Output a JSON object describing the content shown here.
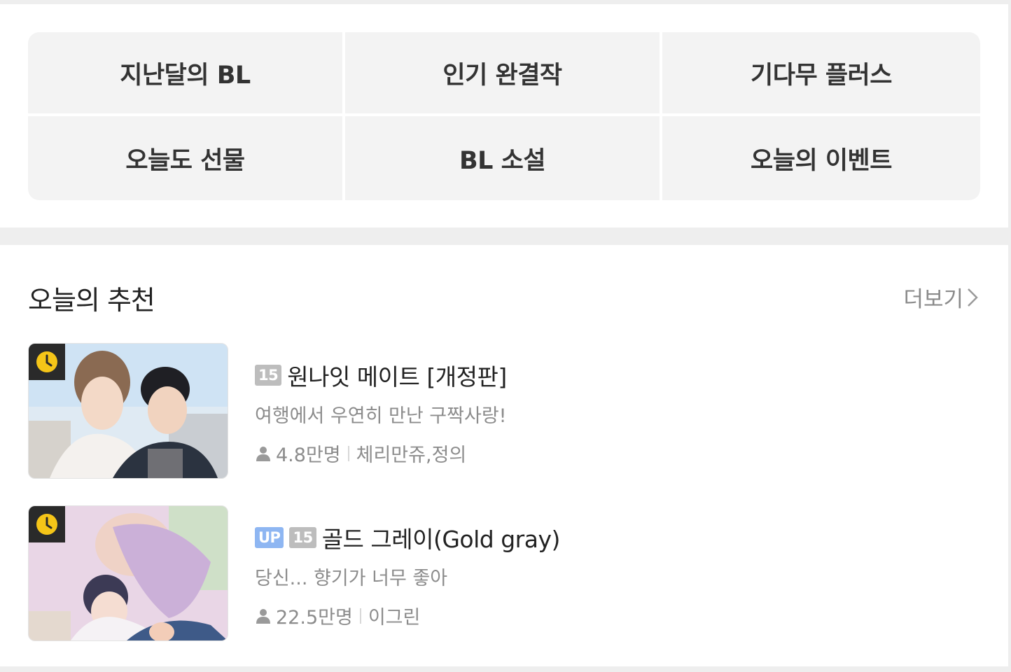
{
  "menu": {
    "items": [
      {
        "label": "지난달의 BL"
      },
      {
        "label": "인기 완결작"
      },
      {
        "label": "기다무 플러스"
      },
      {
        "label": "오늘도 선물"
      },
      {
        "label": "BL 소설"
      },
      {
        "label": "오늘의 이벤트"
      }
    ]
  },
  "recommend": {
    "title": "오늘의 추천",
    "more_label": "더보기",
    "items": [
      {
        "badges": [
          "15"
        ],
        "title": "원나잇 메이트 [개정판]",
        "description": "여행에서 우연히 만난 구짝사랑!",
        "views": "4.8만명",
        "authors": "체리만쥬,정의",
        "thumb_icon": "clock-icon"
      },
      {
        "badges": [
          "UP",
          "15"
        ],
        "title": "골드 그레이(Gold gray)",
        "description": "당신... 향기가 너무 좋아",
        "views": "22.5만명",
        "authors": "이그린",
        "thumb_icon": "clock-icon"
      }
    ]
  },
  "colors": {
    "badge_up": "#8eb6f2",
    "badge_age": "#bdbdbd",
    "clock": "#f5c518",
    "menu_bg": "#f3f3f3"
  }
}
